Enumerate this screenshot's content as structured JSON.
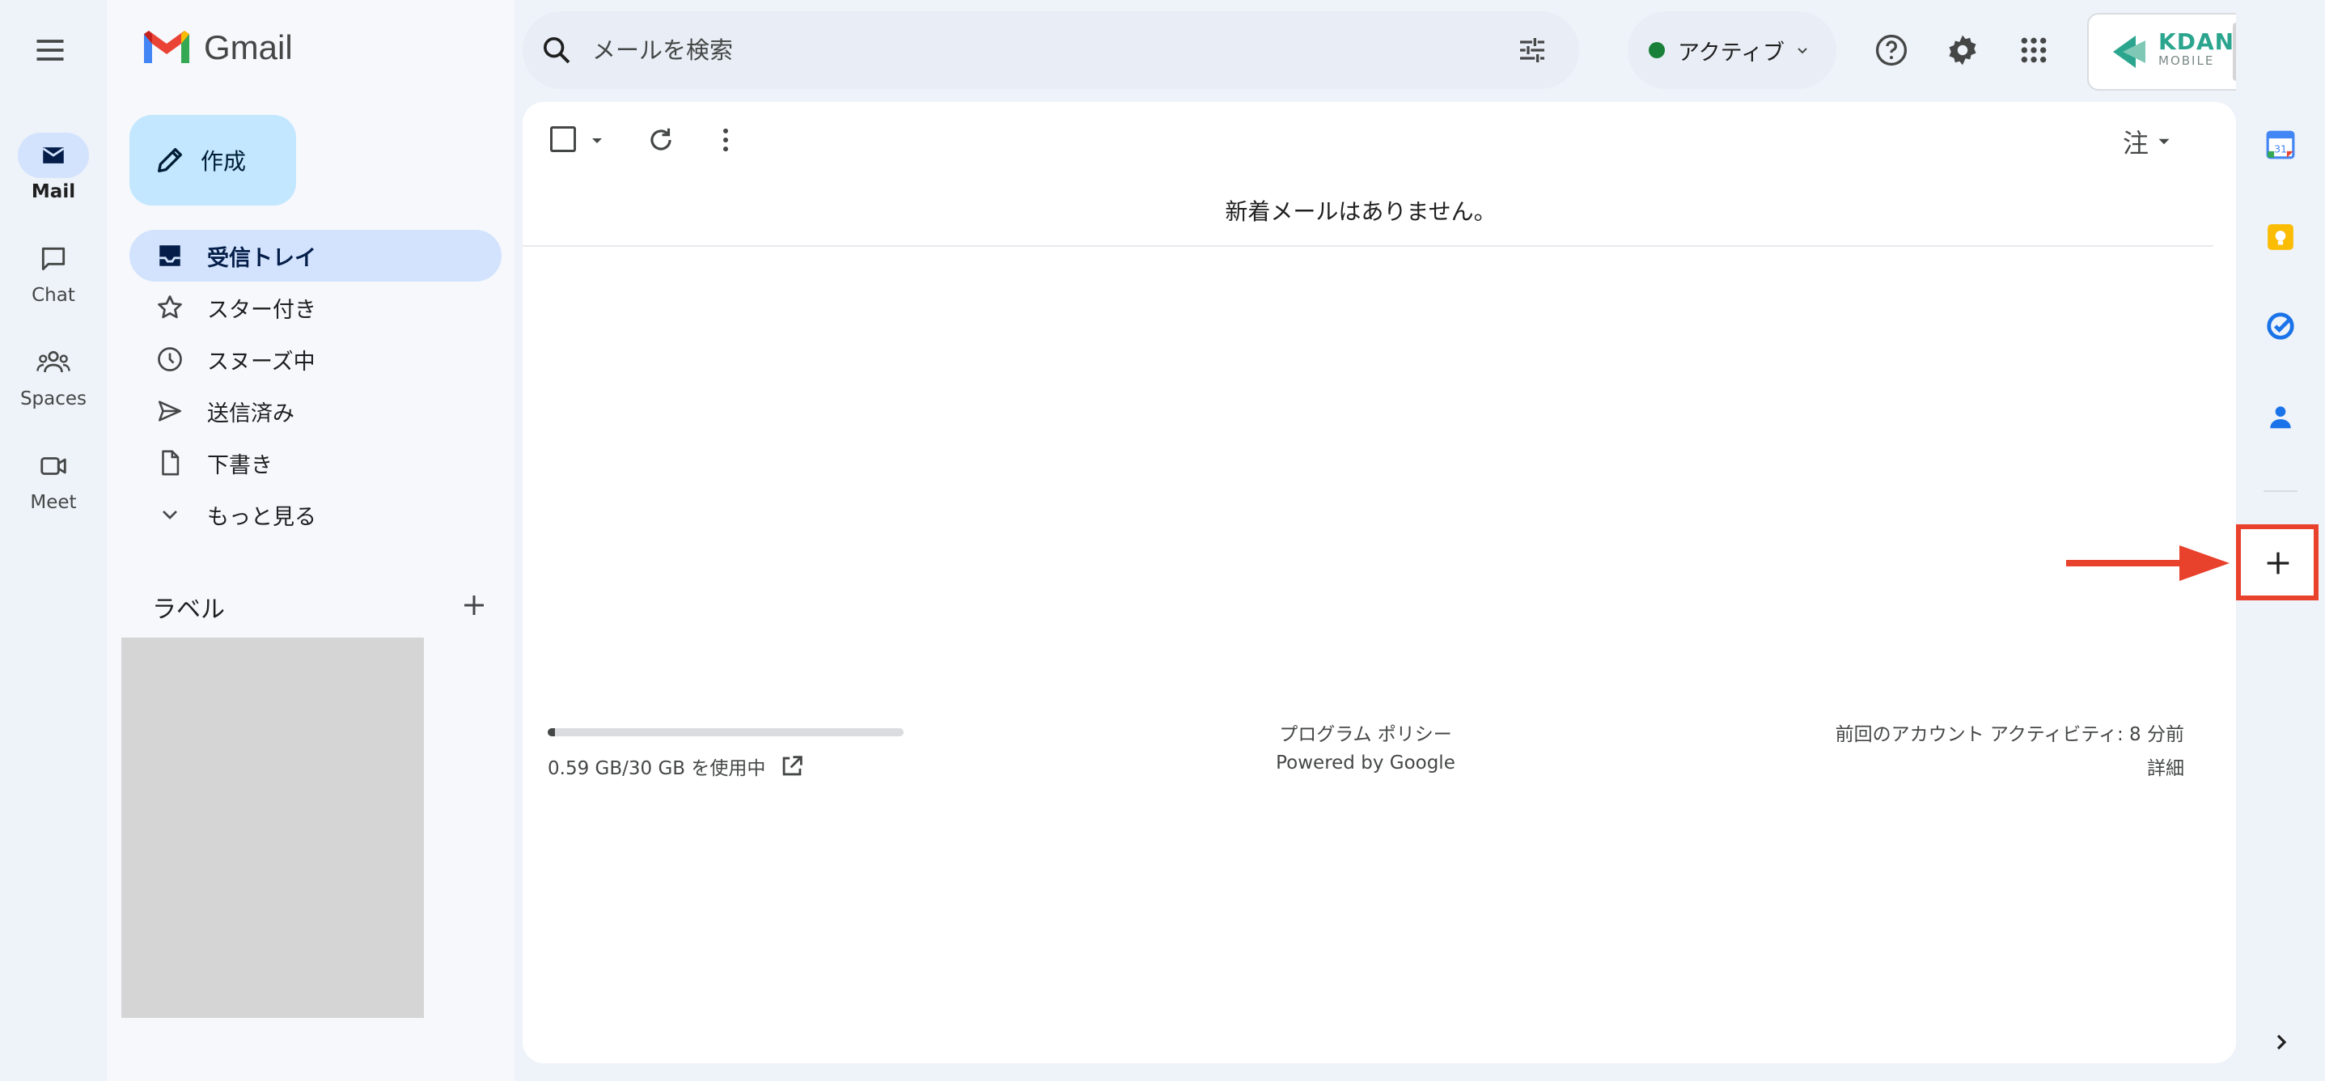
{
  "app": {
    "title": "Gmail"
  },
  "rail": {
    "items": [
      {
        "label": "Mail"
      },
      {
        "label": "Chat"
      },
      {
        "label": "Spaces"
      },
      {
        "label": "Meet"
      }
    ]
  },
  "compose": {
    "label": "作成"
  },
  "nav": {
    "items": [
      {
        "label": "受信トレイ"
      },
      {
        "label": "スター付き"
      },
      {
        "label": "スヌーズ中"
      },
      {
        "label": "送信済み"
      },
      {
        "label": "下書き"
      },
      {
        "label": "もっと見る"
      }
    ],
    "labels_heading": "ラベル"
  },
  "search": {
    "placeholder": "メールを検索"
  },
  "status": {
    "label": "アクティブ",
    "color": "#188038"
  },
  "account": {
    "logo_text": "KDAN",
    "logo_sub": "MOBILE"
  },
  "toolbar": {
    "input_tools_label": "注"
  },
  "main": {
    "empty_message": "新着メールはありません。"
  },
  "footer": {
    "storage": {
      "text": "0.59 GB/30 GB を使用中",
      "used_gb": 0.59,
      "total_gb": 30
    },
    "program_policy": "プログラム ポリシー",
    "powered_by": "Powered by Google",
    "last_activity": "前回のアカウント アクティビティ: 8 分前",
    "details": "詳細"
  },
  "colors": {
    "accent": "#d3e3fd",
    "compose": "#c2e7ff",
    "highlight": "#e8412c"
  }
}
